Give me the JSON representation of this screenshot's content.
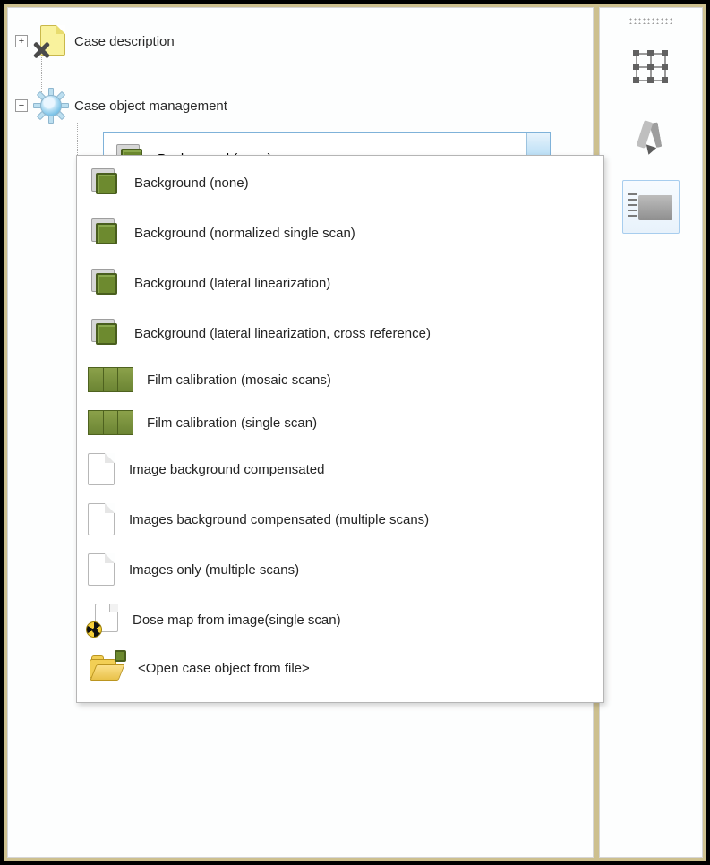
{
  "tree": {
    "case_description": {
      "label": "Case description",
      "expanded": false
    },
    "case_object_mgmt": {
      "label": "Case object management",
      "expanded": true
    }
  },
  "combo": {
    "selected_label": "Background (none)"
  },
  "dropdown": {
    "items": [
      {
        "icon": "sq",
        "label": "Background (none)"
      },
      {
        "icon": "sq",
        "label": "Background (normalized single scan)"
      },
      {
        "icon": "sq",
        "label": "Background (lateral linearization)"
      },
      {
        "icon": "sq",
        "label": "Background (lateral linearization, cross reference)"
      },
      {
        "icon": "film",
        "label": "Film calibration (mosaic scans)"
      },
      {
        "icon": "film",
        "label": "Film calibration (single scan)"
      },
      {
        "icon": "page",
        "label": "Image background compensated"
      },
      {
        "icon": "page",
        "label": "Images background compensated (multiple scans)"
      },
      {
        "icon": "page",
        "label": "Images only (multiple scans)"
      },
      {
        "icon": "rad",
        "label": "Dose map from image(single scan)"
      },
      {
        "icon": "folder",
        "label": "<Open case object from file>"
      }
    ]
  },
  "tools": {
    "grid": {
      "name": "transform-grid",
      "selected": false
    },
    "pen": {
      "name": "draw-pen",
      "selected": false
    },
    "ruler": {
      "name": "ruler-filmstrip",
      "selected": true
    }
  }
}
